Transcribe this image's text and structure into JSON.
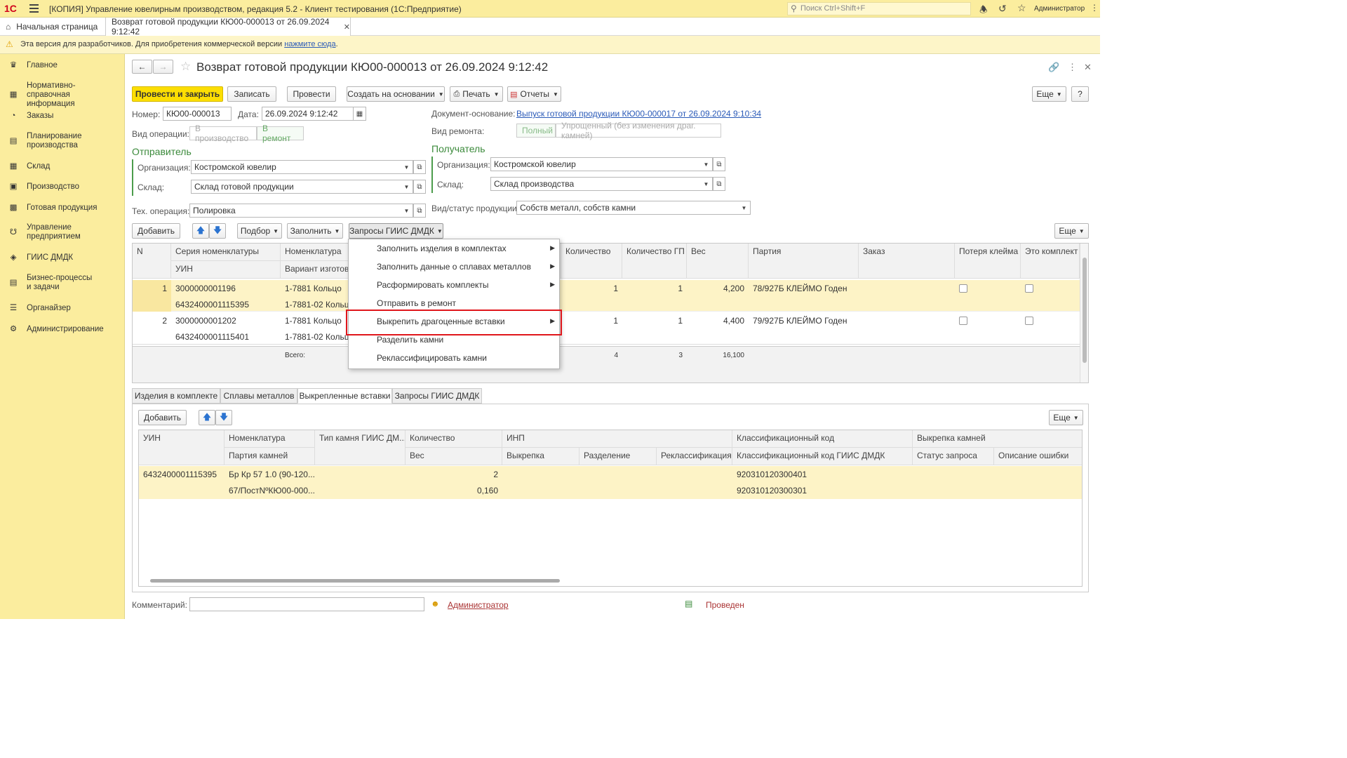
{
  "app": {
    "logo": "1С",
    "title": "[КОПИЯ] Управление ювелирным производством, редакция 5.2  - Клиент тестирования (1С:Предприятие)",
    "search_placeholder": "Поиск Ctrl+Shift+F",
    "user": "Администратор"
  },
  "tabs": {
    "home": "Начальная страница",
    "doc": "Возврат готовой продукции КЮ00-000013 от 26.09.2024 9:12:42"
  },
  "warning": {
    "text": "Эта версия для разработчиков. Для приобретения коммерческой версии ",
    "link": "нажмите сюда",
    "tail": "."
  },
  "sidebar": {
    "items": [
      {
        "label": "Главное",
        "icon": "crown-icon"
      },
      {
        "label": "Нормативно-справочная информация",
        "icon": "book-icon"
      },
      {
        "label": "Заказы",
        "icon": "pie-icon"
      },
      {
        "label": "Планирование производства",
        "icon": "clipboard-icon"
      },
      {
        "label": "Склад",
        "icon": "grid-icon"
      },
      {
        "label": "Производство",
        "icon": "factory-icon"
      },
      {
        "label": "Готовая продукция",
        "icon": "box-icon"
      },
      {
        "label": "Управление предприятием",
        "icon": "org-icon"
      },
      {
        "label": "ГИИС ДМДК",
        "icon": "diamond-icon"
      },
      {
        "label": "Бизнес-процессы и задачи",
        "icon": "tasks-icon"
      },
      {
        "label": "Органайзер",
        "icon": "organizer-icon"
      },
      {
        "label": "Администрирование",
        "icon": "gear-icon"
      }
    ]
  },
  "doc": {
    "title": "Возврат готовой продукции КЮ00-000013 от 26.09.2024 9:12:42",
    "toolbar": {
      "post_close": "Провести и закрыть",
      "save": "Записать",
      "post": "Провести",
      "create_based": "Создать на основании",
      "print": "Печать",
      "reports": "Отчеты",
      "more": "Еще",
      "help": "?"
    },
    "fields": {
      "number_label": "Номер:",
      "number": "КЮ00-000013",
      "date_label": "Дата:",
      "date": "26.09.2024  9:12:42",
      "base_label": "Документ-основание:",
      "base_link": "Выпуск готовой продукции КЮ00-000017 от 26.09.2024 9:10:34",
      "op_label": "Вид операции:",
      "op_options": [
        "В производство",
        "В ремонт"
      ],
      "repair_label": "Вид ремонта:",
      "repair_options": [
        "Полный",
        "Упрощенный (без изменения драг. камней)"
      ],
      "sender_title": "Отправитель",
      "receiver_title": "Получатель",
      "org_label": "Организация:",
      "sender_org": "Костромской ювелир",
      "receiver_org": "Костромской ювелир",
      "wh_label": "Склад:",
      "sender_wh": "Склад готовой продукции",
      "receiver_wh": "Склад производства",
      "techop_label": "Тех. операция:",
      "techop": "Полировка",
      "status_label": "Вид/статус продукции:",
      "status": "Собств металл, собств камни"
    },
    "grid_toolbar": {
      "add": "Добавить",
      "pick": "Подбор",
      "fill": "Заполнить",
      "giis": "Запросы ГИИС ДМДК",
      "more": "Еще"
    },
    "grid": {
      "headers": {
        "n": "N",
        "series": "Серия номенклатуры",
        "uin": "УИН",
        "nom": "Номенклатура",
        "variant": "Вариант изготовления",
        "qty": "Количество",
        "qty_gp": "Количество ГП",
        "weight": "Вес",
        "batch": "Партия",
        "order": "Заказ",
        "lost": "Потеря клейма",
        "kit": "Это комплект"
      },
      "rows": [
        {
          "n": "1",
          "series": "3000000001196",
          "uin": "6432400001115395",
          "nom": "1-7881 Кольцо",
          "variant": "1-7881-02 Кольцо",
          "qty": "1",
          "qty_gp": "1",
          "weight": "4,200",
          "batch": "78/927Б КЛЕЙМО Годен"
        },
        {
          "n": "2",
          "series": "3000000001202",
          "uin": "6432400001115401",
          "nom": "1-7881 Кольцо",
          "variant": "1-7881-02 Кольцо",
          "qty": "1",
          "qty_gp": "1",
          "weight": "4,400",
          "batch": "79/927Б КЛЕЙМО Годен"
        }
      ],
      "totals": {
        "label": "Всего:",
        "qty": "4",
        "qty_gp": "3",
        "weight": "16,100"
      }
    },
    "menu": {
      "items": [
        {
          "label": "Заполнить изделия в комплектах",
          "sub": true
        },
        {
          "label": "Заполнить данные о сплавах металлов",
          "sub": true
        },
        {
          "label": "Расформировать комплекты",
          "sub": true
        },
        {
          "label": "Отправить в ремонт",
          "sub": false
        },
        {
          "label": "Выкрепить драгоценные вставки",
          "sub": true
        },
        {
          "label": "Разделить камни",
          "sub": false
        },
        {
          "label": "Реклассифицировать камни",
          "sub": false
        }
      ],
      "highlight_color": "#e0161b"
    },
    "bottom_tabs": [
      "Изделия в комплекте",
      "Сплавы металлов",
      "Выкрепленные вставки",
      "Запросы ГИИС ДМДК"
    ],
    "sub_toolbar": {
      "add": "Добавить",
      "more": "Еще"
    },
    "sub_grid": {
      "headers": {
        "uin": "УИН",
        "nom": "Номенклатура",
        "batch": "Партия камней",
        "type": "Тип камня ГИИС ДМ...",
        "qty": "Количество",
        "weight": "Вес",
        "inp": "ИНП",
        "vykrepka": "Выкрепка",
        "split": "Разделение",
        "reclass": "Реклассификация",
        "class_code": "Классификационный код",
        "class_code_giis": "Классификационный код ГИИС ДМДК",
        "unset": "Выкрепка камней",
        "req_status": "Статус запроса",
        "err": "Описание ошибки"
      },
      "row": {
        "uin": "6432400001115395",
        "nom": "Бр Кр 57 1.0 (90-120...",
        "batch": "67/ПостNºКЮ00-000...",
        "qty": "2",
        "weight": "0,160",
        "code1": "920310120300401",
        "code2": "920310120300301"
      }
    },
    "footer": {
      "comment_label": "Комментарий:",
      "author": "Администратор",
      "status": "Проведен"
    }
  },
  "colors": {
    "accent": "#fcde03",
    "sidebar": "#fbed9e",
    "row_selected": "#fdf3c6",
    "green": "#3b8a3b"
  }
}
